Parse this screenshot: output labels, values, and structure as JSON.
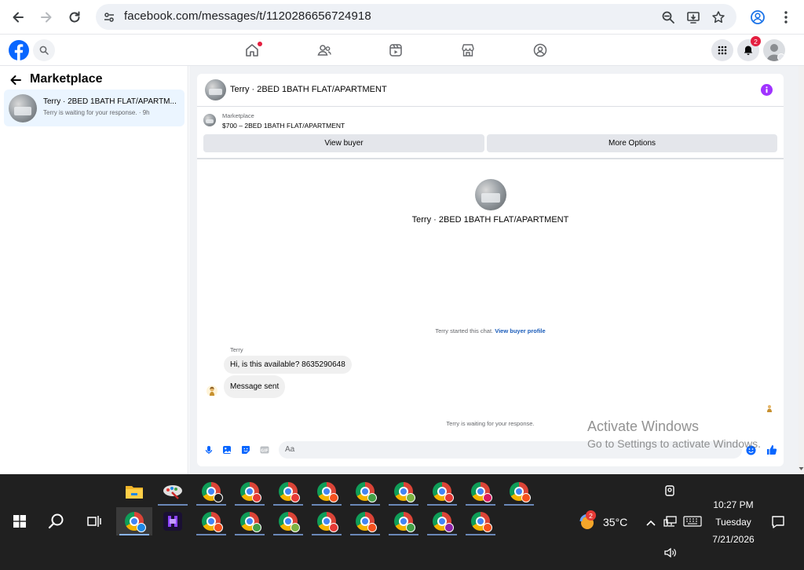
{
  "browser": {
    "url": "facebook.com/messages/t/1120286656724918"
  },
  "fb_nav": {
    "notification_count": "2"
  },
  "sidebar": {
    "title": "Marketplace",
    "conversation": {
      "title": "Terry · 2BED 1BATH FLAT/APARTM...",
      "subtitle": "Terry is waiting for your response. · 9h"
    }
  },
  "chat": {
    "header_title": "Terry · 2BED 1BATH FLAT/APARTMENT",
    "listing_source": "Marketplace",
    "listing_title": "$700 – 2BED 1BATH FLAT/APARTMENT",
    "view_buyer_label": "View buyer",
    "more_options_label": "More Options",
    "profile_name": "Terry · 2BED 1BATH FLAT/APARTMENT",
    "started_text": "Terry started this chat.",
    "view_buyer_profile_link": "View buyer profile",
    "sender_name": "Terry",
    "messages": [
      {
        "text": "Hi, is this available?  8635290648"
      },
      {
        "text": "Message sent"
      }
    ],
    "waiting_text": "Terry is waiting for your response.",
    "composer_placeholder": "Aa"
  },
  "watermark": {
    "line1": "Activate Windows",
    "line2": "Go to Settings to activate Windows."
  },
  "taskbar": {
    "weather_badge": "2",
    "temperature": "35°C",
    "time": "10:27 PM",
    "day": "Tuesday",
    "date": "7/21/2026"
  },
  "colors": {
    "fb_blue": "#0866ff",
    "link_blue": "#1a5cba",
    "info_purple": "#a033ff",
    "notification_red": "#e41e3f",
    "taskbar_bg": "#202020"
  }
}
